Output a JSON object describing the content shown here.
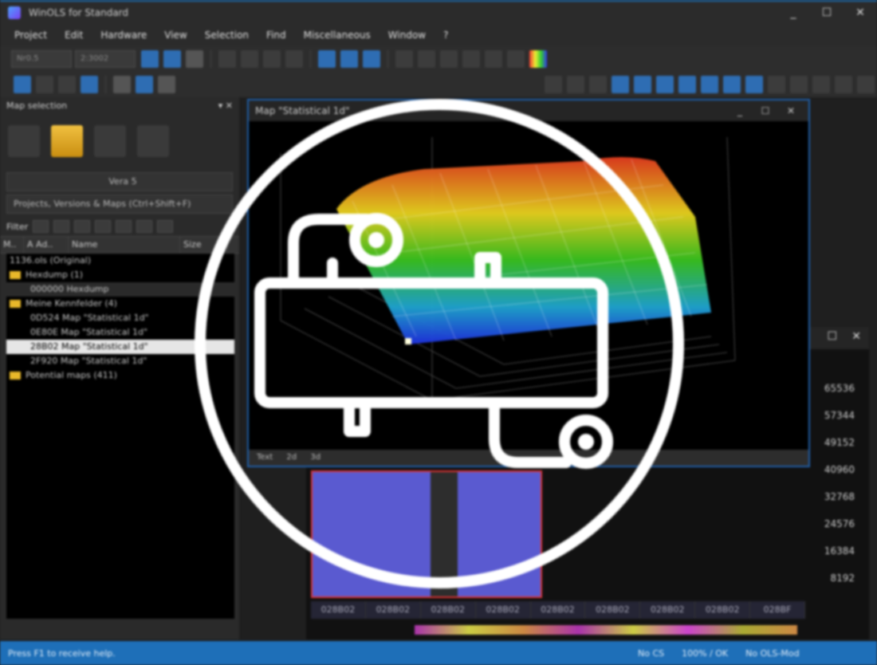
{
  "window": {
    "title": "WinOLS for Standard",
    "min": "_",
    "max": "☐",
    "close": "✕"
  },
  "menu": [
    "Project",
    "Edit",
    "Hardware",
    "View",
    "Selection",
    "Find",
    "Miscellaneous",
    "Window",
    "?"
  ],
  "toolbar": {
    "spin1": "Nr0.5",
    "spin2": "2:3002"
  },
  "left_panel": {
    "title": "Map selection",
    "version_dropdown": "Vera 5",
    "project_dropdown": "Projects, Versions & Maps (Ctrl+Shift+F)",
    "filter_label": "Filter",
    "columns": [
      "M..",
      "A Ad..",
      "Name",
      "Size"
    ],
    "tree": [
      {
        "text": "1136.ols (Original)",
        "type": "root"
      },
      {
        "text": "Hexdump (1)",
        "type": "folder"
      },
      {
        "text": "000000   Hexdump",
        "type": "item",
        "selected": false
      },
      {
        "text": "Meine Kennfelder (4)",
        "type": "folder"
      },
      {
        "text": "0D524   Map \"Statistical 1d\"",
        "type": "item"
      },
      {
        "text": "0E80E   Map \"Statistical 1d\"",
        "type": "item"
      },
      {
        "text": "28B02   Map \"Statistical 1d\"",
        "type": "item",
        "selected": true
      },
      {
        "text": "2F920   Map \"Statistical 1d\"",
        "type": "item"
      },
      {
        "text": "Potential maps (411)",
        "type": "folder"
      }
    ]
  },
  "map_window": {
    "title": "Map \"Statistical 1d\"",
    "status": [
      "Text",
      "2d",
      "3d"
    ]
  },
  "hex_window": {
    "y_ticks": [
      "65536",
      "57344",
      "49152",
      "40960",
      "32768",
      "24576",
      "16384",
      "8192"
    ],
    "addresses": [
      "028B02",
      "028B02",
      "028B02",
      "028B02",
      "028B02",
      "028B02",
      "028B02",
      "028B02",
      "028BF"
    ]
  },
  "statusbar": {
    "help": "Press F1 to receive help.",
    "cs": "No CS",
    "zoom": "100% / OK",
    "module": "No OLS-Mod"
  },
  "colors": {
    "accent": "#1e6fb8",
    "brand": "#2e6db3"
  }
}
